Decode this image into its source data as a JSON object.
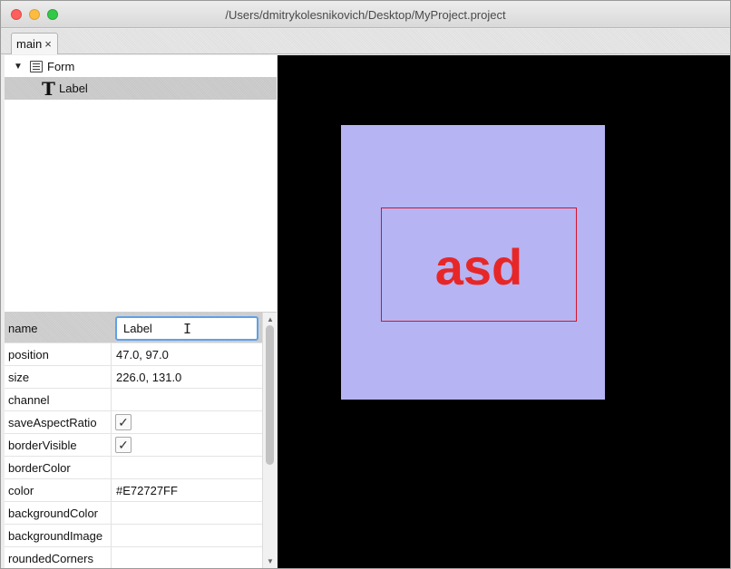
{
  "window": {
    "title": "/Users/dmitrykolesnikovich/Desktop/MyProject.project"
  },
  "tabs": [
    {
      "label": "main",
      "close": "×"
    }
  ],
  "tree": {
    "root": {
      "label": "Form",
      "expanded_glyph": "▼",
      "icon": "form-icon"
    },
    "children": [
      {
        "label": "Label",
        "icon_glyph": "T",
        "icon": "text-icon",
        "selected": true
      }
    ]
  },
  "properties": {
    "name": {
      "label": "name",
      "value": "Label"
    },
    "position": {
      "label": "position",
      "value": "47.0, 97.0"
    },
    "size": {
      "label": "size",
      "value": "226.0, 131.0"
    },
    "channel": {
      "label": "channel",
      "value": ""
    },
    "saveAspectRatio": {
      "label": "saveAspectRatio",
      "checked": true,
      "mark": "✓"
    },
    "borderVisible": {
      "label": "borderVisible",
      "checked": true,
      "mark": "✓"
    },
    "borderColor": {
      "label": "borderColor",
      "value": ""
    },
    "color": {
      "label": "color",
      "value": "#E72727FF"
    },
    "backgroundColor": {
      "label": "backgroundColor",
      "value": ""
    },
    "backgroundImage": {
      "label": "backgroundImage",
      "value": ""
    },
    "roundedCorners": {
      "label": "roundedCorners",
      "value": ""
    }
  },
  "canvas": {
    "label_text": "asd",
    "colors": {
      "background": "#000000",
      "form_fill": "#B6B4F2",
      "text": "#E72727",
      "border": "#D9122A"
    }
  }
}
